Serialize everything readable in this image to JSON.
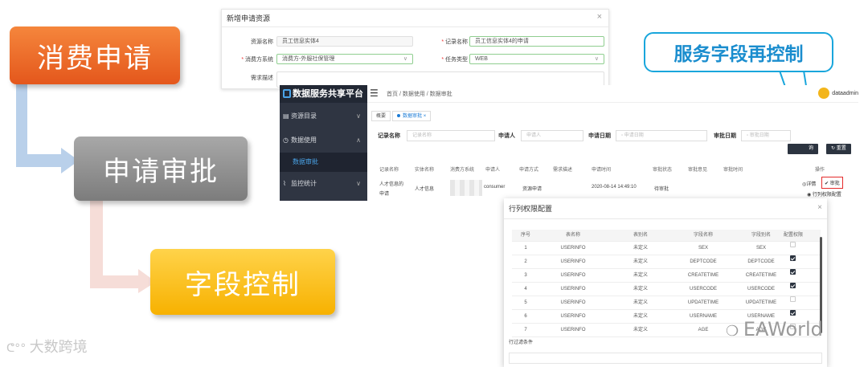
{
  "flow": {
    "step1": "消费申请",
    "step2": "申请审批",
    "step3": "字段控制",
    "colors": {
      "step1": "#e4571c",
      "step2": "#8c8c8c",
      "step3": "#f7b100"
    }
  },
  "callout": {
    "text": "服务字段再控制",
    "color": "#19a6dc"
  },
  "apply_dialog": {
    "title": "新增申请资源",
    "close": "×",
    "fields": {
      "resource_name_label": "资源名称",
      "resource_name_value": "员工信息实体4",
      "record_name_label": "记录名称",
      "record_name_value": "员工信息实体4的申请",
      "consumer_label": "消费方系统",
      "consumer_value": "消费方-外服社保管理",
      "task_type_label": "任务类型",
      "task_type_value": "WEB",
      "desc_label": "需求描述"
    }
  },
  "platform": {
    "brand": "数据服务共享平台",
    "sidebar": {
      "items": [
        {
          "label": "资源目录",
          "chevron": "∨"
        },
        {
          "label": "数据使用",
          "chevron": "∧"
        },
        {
          "label": "监控统计",
          "chevron": "∨"
        }
      ],
      "active_sub": "数据审批"
    },
    "breadcrumb": "首页  /  数据使用  /  数据审批",
    "user": "dataadmin",
    "tabs": [
      "概要",
      "数据审批"
    ],
    "tab_close": "×",
    "filters": {
      "record_label": "记录名称",
      "record_ph": "记录名称",
      "applicant_label": "申请人",
      "applicant_ph": "申请人",
      "apply_date_label": "申请日期",
      "apply_date_ph": "申请日期",
      "approve_date_label": "审批日期",
      "approve_date_ph": "审批日期",
      "query_btn": "询",
      "reset_btn": "重置"
    },
    "table": {
      "headers": [
        "记录名称",
        "实体名称",
        "消费方系统",
        "申请人",
        "申请方式",
        "需求描述",
        "申请时间",
        "审批状态",
        "审批意见",
        "审批时间",
        "操作"
      ],
      "row": {
        "record": "人才信息的",
        "record2": "申请",
        "entity": "人才信息",
        "applicant": "consumer",
        "method": "资源申请",
        "time": "2020-08-14 14:49:10",
        "status": "待审批",
        "op_detail": "详情",
        "op_approve": "审批",
        "op_perm": "行列权限配置"
      }
    }
  },
  "perm_dialog": {
    "title": "行列权限配置",
    "close": "×",
    "headers": [
      "序号",
      "表名称",
      "表别名",
      "字段名称",
      "字段别名",
      "配置权限"
    ],
    "rows": [
      {
        "no": "1",
        "table": "USERINFO",
        "alias": "未定义",
        "field": "SEX",
        "field_alias": "SEX",
        "checked": false
      },
      {
        "no": "2",
        "table": "USERINFO",
        "alias": "未定义",
        "field": "DEPTCODE",
        "field_alias": "DEPTCODE",
        "checked": true
      },
      {
        "no": "3",
        "table": "USERINFO",
        "alias": "未定义",
        "field": "CREATETIME",
        "field_alias": "CREATETIME",
        "checked": true
      },
      {
        "no": "4",
        "table": "USERINFO",
        "alias": "未定义",
        "field": "USERCODE",
        "field_alias": "USERCODE",
        "checked": true
      },
      {
        "no": "5",
        "table": "USERINFO",
        "alias": "未定义",
        "field": "UPDATETIME",
        "field_alias": "UPDATETIME",
        "checked": false
      },
      {
        "no": "6",
        "table": "USERINFO",
        "alias": "未定义",
        "field": "USERNAME",
        "field_alias": "USERNAME",
        "checked": true
      },
      {
        "no": "7",
        "table": "USERINFO",
        "alias": "未定义",
        "field": "AGE",
        "field_alias": "AGE",
        "checked": false
      }
    ],
    "row_filter": "行过滤条件"
  },
  "watermarks": {
    "left": "大数跨境",
    "right": "EAWorld"
  }
}
